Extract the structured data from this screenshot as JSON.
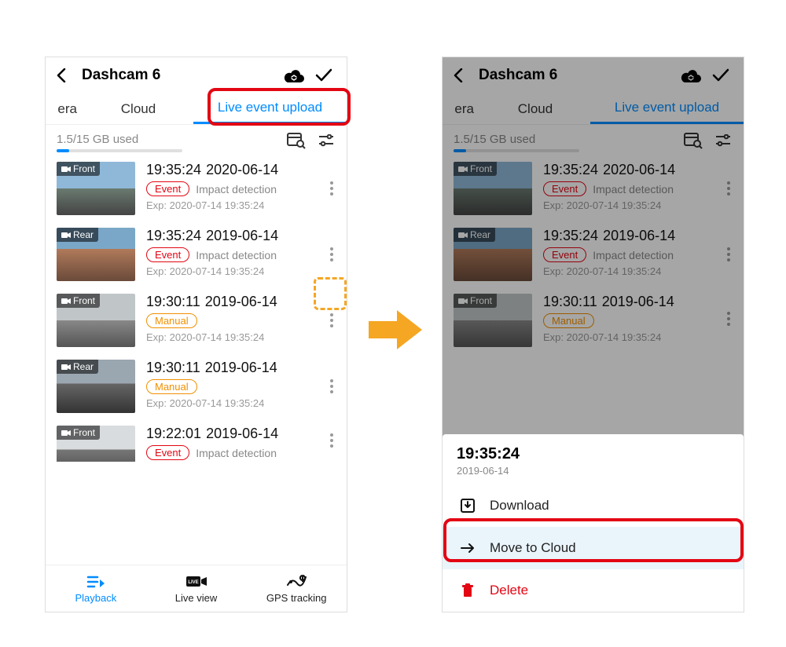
{
  "header": {
    "title": "Dashcam 6"
  },
  "tabs": {
    "cut": "era",
    "cloud": "Cloud",
    "live": "Live event upload"
  },
  "storage": {
    "text": "1.5/15 GB used",
    "fill_pct": 10
  },
  "events": [
    {
      "cam": "Front",
      "time": "19:35:24",
      "date": "2020-06-14",
      "badge": "Event",
      "badge_kind": "event",
      "detect": "Impact detection",
      "exp": "Exp: 2020-07-14 19:35:24",
      "thumb": "sky1"
    },
    {
      "cam": "Rear",
      "time": "19:35:24",
      "date": "2019-06-14",
      "badge": "Event",
      "badge_kind": "event",
      "detect": "Impact detection",
      "exp": "Exp: 2020-07-14 19:35:24",
      "thumb": "sky2"
    },
    {
      "cam": "Front",
      "time": "19:30:11",
      "date": "2019-06-14",
      "badge": "Manual",
      "badge_kind": "manual",
      "detect": "",
      "exp": "Exp: 2020-07-14 19:35:24",
      "thumb": "sky3"
    },
    {
      "cam": "Rear",
      "time": "19:30:11",
      "date": "2019-06-14",
      "badge": "Manual",
      "badge_kind": "manual",
      "detect": "",
      "exp": "Exp: 2020-07-14 19:35:24",
      "thumb": "sky4"
    },
    {
      "cam": "Front",
      "time": "19:22:01",
      "date": "2019-06-14",
      "badge": "Event",
      "badge_kind": "event",
      "detect": "Impact detection",
      "exp": "",
      "thumb": "sky5"
    }
  ],
  "bottom_nav": {
    "playback": "Playback",
    "liveview": "Live view",
    "gps": "GPS tracking"
  },
  "sheet": {
    "time": "19:35:24",
    "date": "2019-06-14",
    "download": "Download",
    "move": "Move to Cloud",
    "delete": "Delete"
  }
}
